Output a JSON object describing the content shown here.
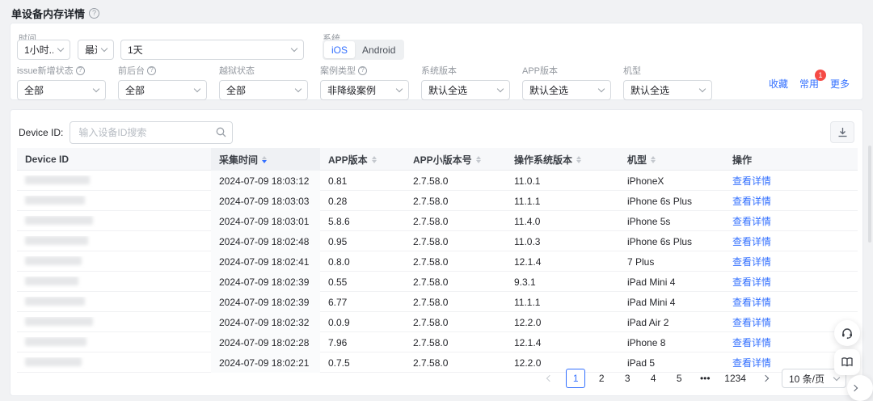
{
  "page": {
    "title": "单设备内存详情"
  },
  "colors": {
    "accent": "#3370ff",
    "badge": "#f54a45",
    "text": "#25262b",
    "label": "#9499a0"
  },
  "filters": {
    "time": {
      "label": "时间",
      "granularity": "1小时...",
      "range_type": "最近",
      "range_value": "1天"
    },
    "system": {
      "label": "系统",
      "options": [
        "iOS",
        "Android"
      ],
      "selected": "iOS"
    },
    "selects": [
      {
        "label": "issue新增状态",
        "help": true,
        "value": "全部"
      },
      {
        "label": "前后台",
        "help": true,
        "value": "全部"
      },
      {
        "label": "越狱状态",
        "help": false,
        "value": "全部"
      },
      {
        "label": "案例类型",
        "help": true,
        "value": "非降级案例"
      },
      {
        "label": "系统版本",
        "help": false,
        "value": "默认全选"
      },
      {
        "label": "APP版本",
        "help": false,
        "value": "默认全选"
      },
      {
        "label": "机型",
        "help": false,
        "value": "默认全选"
      }
    ],
    "actions": {
      "favorite": "收藏",
      "frequent": "常用",
      "frequent_badge": "1",
      "more": "更多"
    }
  },
  "search": {
    "label": "Device ID:",
    "placeholder": "输入设备ID搜索"
  },
  "table": {
    "columns": [
      {
        "label": "Device ID",
        "sortable": false
      },
      {
        "label": "采集时间",
        "sortable": true,
        "sorted": "desc"
      },
      {
        "label": "APP版本",
        "sortable": true
      },
      {
        "label": "APP小版本号",
        "sortable": true
      },
      {
        "label": "操作系统版本",
        "sortable": true
      },
      {
        "label": "机型",
        "sortable": true
      },
      {
        "label": "操作",
        "sortable": false
      }
    ],
    "action_label": "查看详情",
    "rows": [
      {
        "time": "2024-07-09 18:03:12",
        "app_version": "0.81",
        "app_minor_version": "2.7.58.0",
        "os_version": "11.0.1",
        "model": "iPhoneX"
      },
      {
        "time": "2024-07-09 18:03:03",
        "app_version": "0.28",
        "app_minor_version": "2.7.58.0",
        "os_version": "11.1.1",
        "model": "iPhone 6s Plus"
      },
      {
        "time": "2024-07-09 18:03:01",
        "app_version": "5.8.6",
        "app_minor_version": "2.7.58.0",
        "os_version": "11.4.0",
        "model": "iPhone 5s"
      },
      {
        "time": "2024-07-09 18:02:48",
        "app_version": "0.95",
        "app_minor_version": "2.7.58.0",
        "os_version": "11.0.3",
        "model": "iPhone 6s Plus"
      },
      {
        "time": "2024-07-09 18:02:41",
        "app_version": "0.8.0",
        "app_minor_version": "2.7.58.0",
        "os_version": "12.1.4",
        "model": "7 Plus"
      },
      {
        "time": "2024-07-09 18:02:39",
        "app_version": "0.55",
        "app_minor_version": "2.7.58.0",
        "os_version": "9.3.1",
        "model": "iPad Mini 4"
      },
      {
        "time": "2024-07-09 18:02:39",
        "app_version": "6.77",
        "app_minor_version": "2.7.58.0",
        "os_version": "11.1.1",
        "model": "iPad Mini 4"
      },
      {
        "time": "2024-07-09 18:02:32",
        "app_version": "0.0.9",
        "app_minor_version": "2.7.58.0",
        "os_version": "12.2.0",
        "model": "iPad Air 2"
      },
      {
        "time": "2024-07-09 18:02:28",
        "app_version": "7.96",
        "app_minor_version": "2.7.58.0",
        "os_version": "12.1.4",
        "model": "iPhone 8"
      },
      {
        "time": "2024-07-09 18:02:21",
        "app_version": "0.7.5",
        "app_minor_version": "2.7.58.0",
        "os_version": "12.2.0",
        "model": "iPad 5"
      }
    ]
  },
  "pagination": {
    "pages": [
      "1",
      "2",
      "3",
      "4",
      "5",
      "•••",
      "1234"
    ],
    "active": "1",
    "page_size": "10 条/页"
  }
}
